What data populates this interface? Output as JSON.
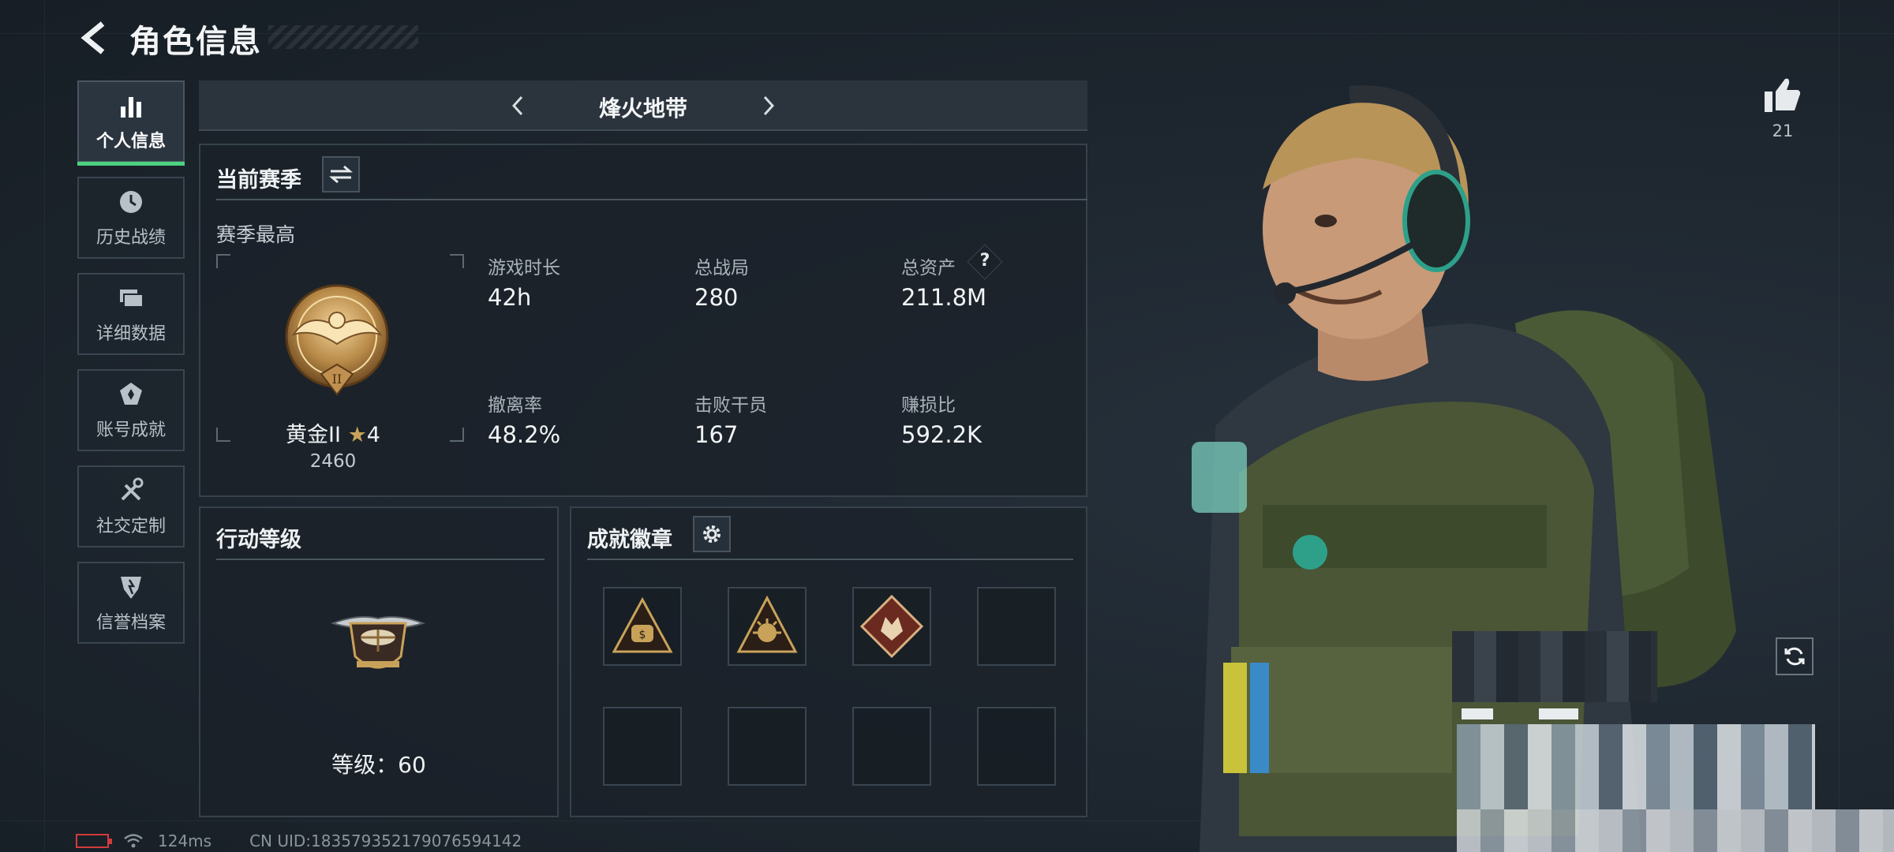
{
  "header": {
    "title": "角色信息"
  },
  "sidebar": {
    "items": [
      {
        "label": "个人信息",
        "icon": "bar-chart-icon",
        "active": true
      },
      {
        "label": "历史战绩",
        "icon": "clock-icon",
        "active": false
      },
      {
        "label": "详细数据",
        "icon": "folder-icon",
        "active": false
      },
      {
        "label": "账号成就",
        "icon": "medal-icon",
        "active": false
      },
      {
        "label": "社交定制",
        "icon": "tools-icon",
        "active": false
      },
      {
        "label": "信誉档案",
        "icon": "shield-icon",
        "active": false
      }
    ]
  },
  "map_selector": {
    "name": "烽火地带"
  },
  "season": {
    "title": "当前赛季",
    "subtitle": "赛季最高",
    "rank_name": "黄金II",
    "rank_stars": "4",
    "rank_score": "2460",
    "stats": [
      {
        "label": "游戏时长",
        "value": "42h"
      },
      {
        "label": "总战局",
        "value": "280"
      },
      {
        "label": "总资产",
        "value": "211.8M"
      },
      {
        "label": "撤离率",
        "value": "48.2%"
      },
      {
        "label": "击败干员",
        "value": "167"
      },
      {
        "label": "赚损比",
        "value": "592.2K"
      }
    ],
    "help_glyph": "?"
  },
  "action_level": {
    "title": "行动等级",
    "level_text": "等级：60"
  },
  "achievements": {
    "title": "成就徽章",
    "badges": [
      {
        "icon": "triangle-money-badge-icon"
      },
      {
        "icon": "triangle-sun-badge-icon"
      },
      {
        "icon": "diamond-wolf-badge-icon"
      },
      {
        "icon": "empty-slot"
      },
      {
        "icon": "empty-slot"
      },
      {
        "icon": "empty-slot"
      },
      {
        "icon": "empty-slot"
      },
      {
        "icon": "empty-slot"
      }
    ]
  },
  "likes": {
    "count": "21"
  },
  "status": {
    "ping": "124ms",
    "uid": "CN UID:1835793521790765941​42"
  },
  "colors": {
    "accent_green": "#4dd17e",
    "bg": "#1d252e",
    "panel_border": "#36414b",
    "gold": "#c9a25a"
  }
}
